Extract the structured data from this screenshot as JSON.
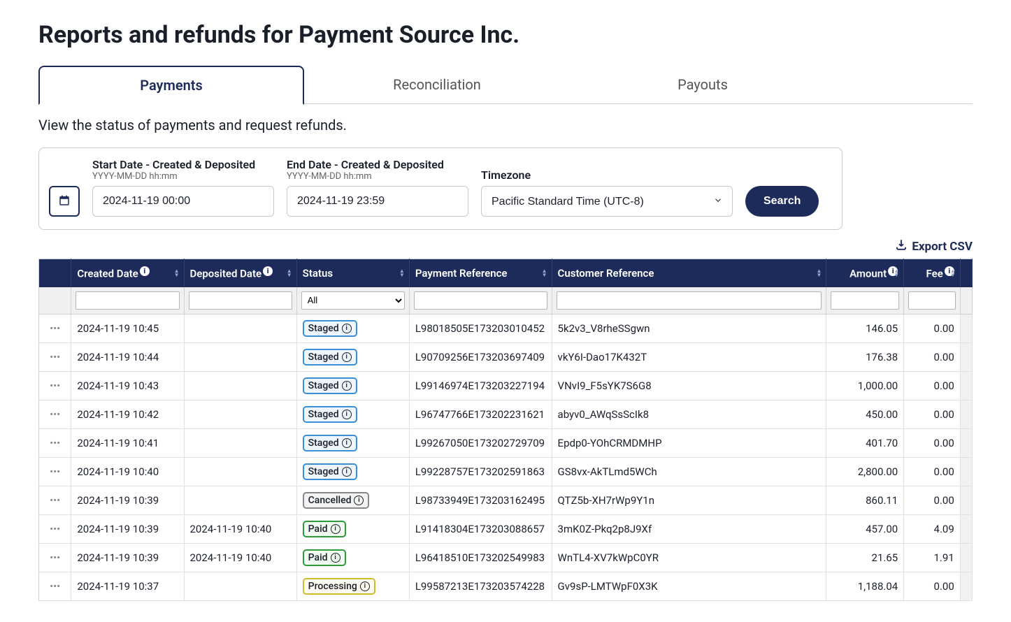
{
  "page_title": "Reports and refunds for Payment Source Inc.",
  "tabs": [
    {
      "label": "Payments",
      "active": true
    },
    {
      "label": "Reconciliation",
      "active": false
    },
    {
      "label": "Payouts",
      "active": false
    }
  ],
  "subtitle": "View the status of payments and request refunds.",
  "search": {
    "start_label": "Start Date - Created & Deposited",
    "start_hint": "YYYY-MM-DD hh:mm",
    "start_value": "2024-11-19 00:00",
    "end_label": "End Date - Created & Deposited",
    "end_hint": "YYYY-MM-DD hh:mm",
    "end_value": "2024-11-19 23:59",
    "tz_label": "Timezone",
    "tz_value": "Pacific Standard Time (UTC-8)",
    "button": "Search"
  },
  "export_label": "Export CSV",
  "columns": {
    "created": "Created Date",
    "deposited": "Deposited Date",
    "status": "Status",
    "payref": "Payment Reference",
    "custref": "Customer Reference",
    "amount": "Amount",
    "fee": "Fee"
  },
  "status_filter_value": "All",
  "status_styles": {
    "Staged": "badge-staged",
    "Paid": "badge-paid",
    "Cancelled": "badge-cancelled",
    "Processing": "badge-processing"
  },
  "rows": [
    {
      "created": "2024-11-19 10:45",
      "deposited": "",
      "status": "Staged",
      "payref": "L98018505E173203010452",
      "custref": "5k2v3_V8rheSSgwn",
      "amount": "146.05",
      "fee": "0.00"
    },
    {
      "created": "2024-11-19 10:44",
      "deposited": "",
      "status": "Staged",
      "payref": "L90709256E173203697409",
      "custref": "vkY6I-Dao17K432T",
      "amount": "176.38",
      "fee": "0.00"
    },
    {
      "created": "2024-11-19 10:43",
      "deposited": "",
      "status": "Staged",
      "payref": "L99146974E173203227194",
      "custref": "VNvI9_F5sYK7S6G8",
      "amount": "1,000.00",
      "fee": "0.00"
    },
    {
      "created": "2024-11-19 10:42",
      "deposited": "",
      "status": "Staged",
      "payref": "L96747766E173202231621",
      "custref": "abyv0_AWqSsScIk8",
      "amount": "450.00",
      "fee": "0.00"
    },
    {
      "created": "2024-11-19 10:41",
      "deposited": "",
      "status": "Staged",
      "payref": "L99267050E173202729709",
      "custref": "Epdp0-YOhCRMDMHP",
      "amount": "401.70",
      "fee": "0.00"
    },
    {
      "created": "2024-11-19 10:40",
      "deposited": "",
      "status": "Staged",
      "payref": "L99228757E173202591863",
      "custref": "GS8vx-AkTLmd5WCh",
      "amount": "2,800.00",
      "fee": "0.00"
    },
    {
      "created": "2024-11-19 10:39",
      "deposited": "",
      "status": "Cancelled",
      "payref": "L98733949E173203162495",
      "custref": "QTZ5b-XH7rWp9Y1n",
      "amount": "860.11",
      "fee": "0.00"
    },
    {
      "created": "2024-11-19 10:39",
      "deposited": "2024-11-19 10:40",
      "status": "Paid",
      "payref": "L91418304E173203088657",
      "custref": "3mK0Z-Pkq2p8J9Xf",
      "amount": "457.00",
      "fee": "4.09"
    },
    {
      "created": "2024-11-19 10:39",
      "deposited": "2024-11-19 10:40",
      "status": "Paid",
      "payref": "L96418510E173202549983",
      "custref": "WnTL4-XV7kWpC0YR",
      "amount": "21.65",
      "fee": "1.91"
    },
    {
      "created": "2024-11-19 10:37",
      "deposited": "",
      "status": "Processing",
      "payref": "L99587213E173203574228",
      "custref": "Gv9sP-LMTWpF0X3K",
      "amount": "1,188.04",
      "fee": "0.00"
    }
  ]
}
